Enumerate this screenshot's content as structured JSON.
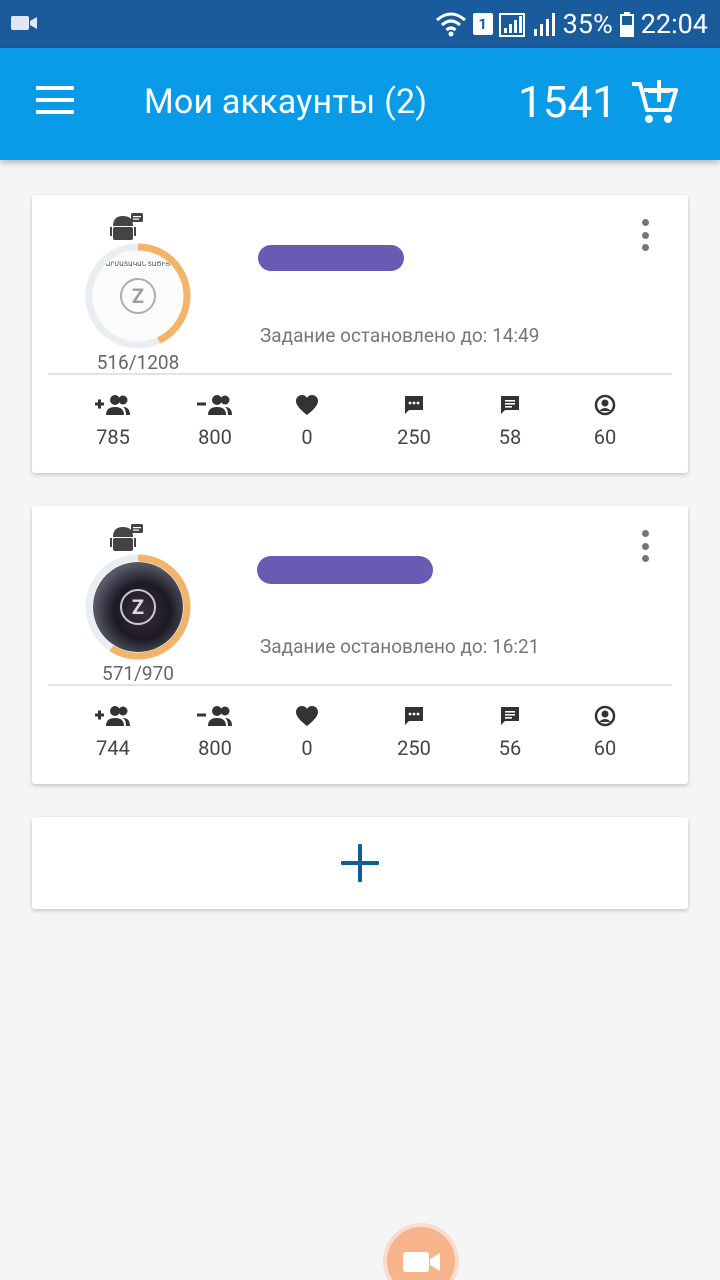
{
  "status_bar": {
    "sim_slot": "1",
    "battery": "35%",
    "time": "22:04"
  },
  "app_bar": {
    "title": "Мои аккаунты (2)",
    "balance": "1541"
  },
  "accounts": [
    {
      "avatar_text": "ԱՐՄԱՏԱԿԱՆ ՏԱԾԻՑ",
      "counter": "516/1208",
      "counter_progress": 0.43,
      "status": "Задание остановлено до: 14:49",
      "stats": [
        "785",
        "800",
        "0",
        "250",
        "58",
        "60"
      ]
    },
    {
      "counter": "571/970",
      "counter_progress": 0.59,
      "status": "Задание остановлено до: 16:21",
      "stats": [
        "744",
        "800",
        "0",
        "250",
        "56",
        "60"
      ]
    }
  ],
  "stat_icons": [
    "follow-add-icon",
    "unfollow-icon",
    "like-heart-icon",
    "comment-icon",
    "message-icon",
    "profile-view-icon"
  ],
  "colors": {
    "status_bar": "#1a5b9c",
    "app_bar": "#0a9be8",
    "progress_ring": "#f2b46a",
    "redaction": "#6a5ab3",
    "add_plus": "#0d5f98",
    "fab": "#f7b38a"
  }
}
